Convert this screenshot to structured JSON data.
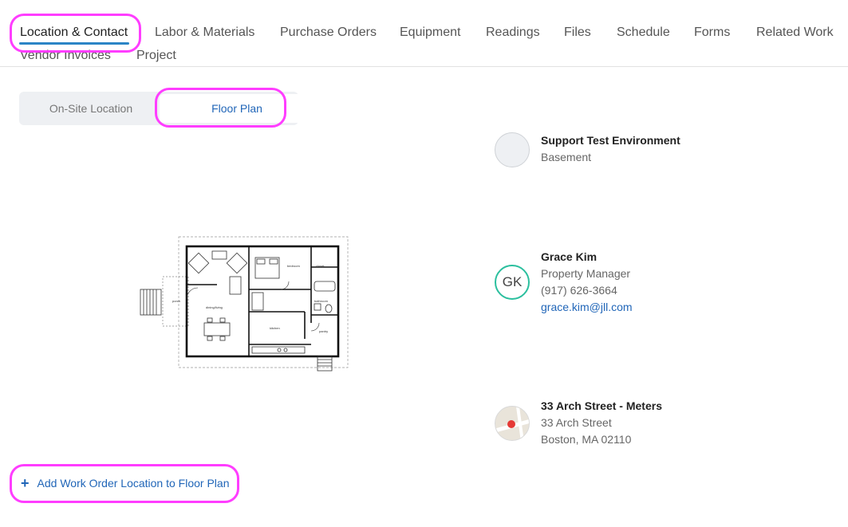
{
  "tabs": [
    {
      "label": "Location & Contact",
      "active": true
    },
    {
      "label": "Labor & Materials"
    },
    {
      "label": "Purchase Orders"
    },
    {
      "label": "Equipment"
    },
    {
      "label": "Readings"
    },
    {
      "label": "Files"
    },
    {
      "label": "Schedule"
    },
    {
      "label": "Forms"
    },
    {
      "label": "Related Work"
    },
    {
      "label": "Vendor Invoices"
    },
    {
      "label": "Project"
    }
  ],
  "segmented": {
    "options": [
      "On-Site Location",
      "Floor Plan"
    ],
    "selected": "Floor Plan"
  },
  "floorplan": {
    "labels": {
      "porch": "porch",
      "living": "dining/living",
      "bedroom": "bedroom",
      "kitchen": "kitchen",
      "bathroom": "bathroom",
      "closet": "closet",
      "pantry": "pantry"
    }
  },
  "location_card": {
    "title": "Support Test Environment",
    "subtitle": "Basement"
  },
  "contact_card": {
    "initials": "GK",
    "name": "Grace Kim",
    "role": "Property Manager",
    "phone": "(917) 626-3664",
    "email": "grace.kim@jll.com"
  },
  "address_card": {
    "title": "33 Arch Street - Meters",
    "line1": "33 Arch Street",
    "line2": "Boston, MA 02110"
  },
  "add_location_label": "Add Work Order Location to Floor Plan",
  "colors": {
    "accent": "#2166b8",
    "underline": "#2b84c6",
    "avatar_ring": "#2bbf9e",
    "highlight": "#ff3dff"
  }
}
